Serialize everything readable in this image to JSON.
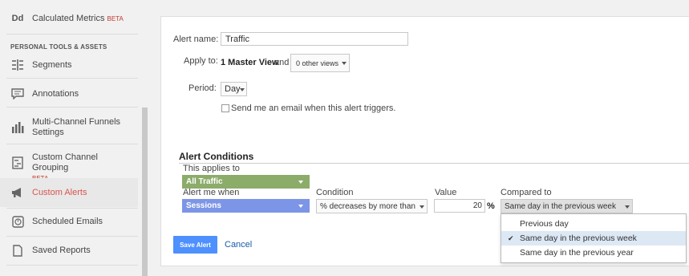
{
  "sidebar": {
    "top_item": {
      "icon_text": "Dd",
      "label": "Calculated Metrics",
      "badge": "BETA"
    },
    "section_title": "PERSONAL TOOLS & ASSETS",
    "items": [
      {
        "label": "Segments",
        "icon": "segments-icon"
      },
      {
        "label": "Annotations",
        "icon": "annotations-icon"
      },
      {
        "label": "Multi-Channel Funnels Settings",
        "icon": "bar-chart-icon"
      },
      {
        "label": "Custom Channel Grouping",
        "badge": "BETA",
        "icon": "channel-grouping-icon"
      },
      {
        "label": "Custom Alerts",
        "icon": "megaphone-icon",
        "active": true
      },
      {
        "label": "Scheduled Emails",
        "icon": "clock-icon"
      },
      {
        "label": "Saved Reports",
        "icon": "document-icon"
      }
    ]
  },
  "form": {
    "alert_name_label": "Alert name:",
    "alert_name_value": "Traffic",
    "apply_to_label": "Apply to:",
    "apply_to_view": "1 Master View",
    "apply_to_and": "and",
    "other_views": "0 other views",
    "period_label": "Period:",
    "period_value": "Day",
    "email_checkbox_label": "Send me an email when this alert triggers.",
    "email_checked": false
  },
  "conditions": {
    "title": "Alert Conditions",
    "applies_to_label": "This applies to",
    "applies_to_value": "All Traffic",
    "alert_me_label": "Alert me when",
    "alert_me_value": "Sessions",
    "condition_label": "Condition",
    "condition_value": "% decreases by more than",
    "value_label": "Value",
    "value": "20",
    "value_unit": "%",
    "compared_label": "Compared to",
    "compared_value": "Same day in the previous week",
    "compared_options": [
      "Previous day",
      "Same day in the previous week",
      "Same day in the previous year"
    ],
    "selected_option_index": 1
  },
  "actions": {
    "save": "Save Alert",
    "cancel": "Cancel"
  },
  "colors": {
    "applies_to_bg": "#8cac6a",
    "alert_me_bg": "#7d95e6",
    "save_bg": "#4d90fe",
    "active_text": "#d9534f"
  }
}
